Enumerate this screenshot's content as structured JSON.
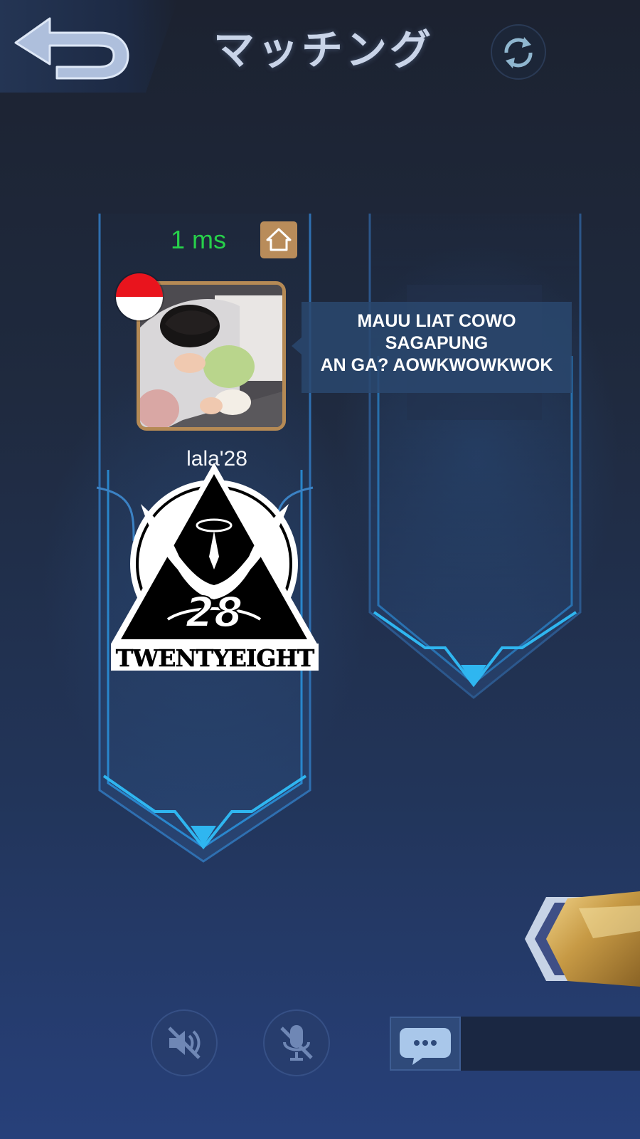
{
  "header": {
    "title": "マッチング",
    "back_icon": "back-arrow-icon",
    "refresh_icon": "refresh-icon"
  },
  "player_slot": {
    "ping": "1 ms",
    "ping_color": "#27d04a",
    "home_icon": "home-icon",
    "flag": "indonesia-flag-icon",
    "name": "lala'28",
    "chat_message_lines": [
      "MAUU LIAT COWO",
      "SAGAPUNG",
      "AN GA? AOWKWOWKWOK"
    ],
    "emblem_text": "TWENTYEIGHT",
    "emblem_number": "28"
  },
  "empty_slot": {
    "state": "empty"
  },
  "bottom_bar": {
    "speaker_icon": "speaker-muted-icon",
    "mic_icon": "mic-muted-icon",
    "chat_icon": "chat-bubble-icon",
    "chat_input_value": ""
  },
  "colors": {
    "accent_blue": "#2fb6f0",
    "frame_gold": "#b58a55",
    "title_color": "#c9d4e8"
  }
}
